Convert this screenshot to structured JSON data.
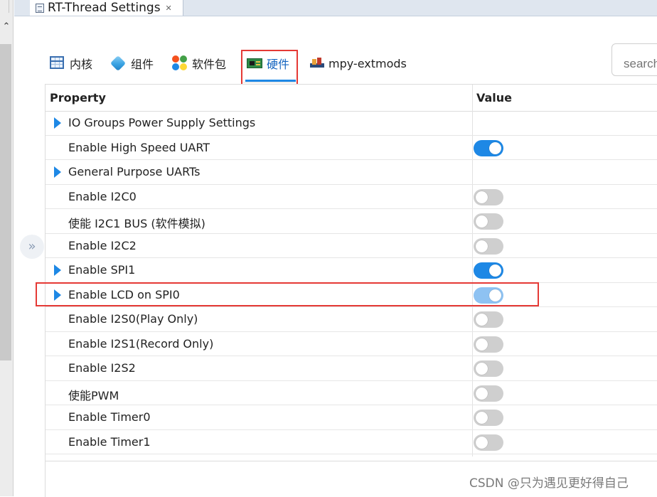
{
  "editor": {
    "tab_title": "RT-Thread Settings",
    "close_glyph": "✕"
  },
  "tabs": [
    {
      "label": "内核",
      "icon": "kernel-icon"
    },
    {
      "label": "组件",
      "icon": "component-icon"
    },
    {
      "label": "软件包",
      "icon": "package-icon"
    },
    {
      "label": "硬件",
      "icon": "hardware-icon",
      "active": true
    },
    {
      "label": "mpy-extmods",
      "icon": "mpy-extmods-icon"
    }
  ],
  "search": {
    "placeholder": "search"
  },
  "table": {
    "headers": {
      "property": "Property",
      "value": "Value"
    },
    "rows": [
      {
        "label": "IO Groups Power Supply Settings",
        "expandable": true,
        "toggle": null
      },
      {
        "label": "Enable High Speed UART",
        "expandable": false,
        "toggle": "on"
      },
      {
        "label": "General Purpose UARTs",
        "expandable": true,
        "toggle": null
      },
      {
        "label": "Enable I2C0",
        "expandable": false,
        "toggle": "off"
      },
      {
        "label": "使能 I2C1 BUS (软件模拟)",
        "expandable": false,
        "toggle": "off"
      },
      {
        "label": "Enable I2C2",
        "expandable": false,
        "toggle": "off"
      },
      {
        "label": "Enable SPI1",
        "expandable": true,
        "toggle": "on"
      },
      {
        "label": "Enable LCD on SPI0",
        "expandable": true,
        "toggle": "on-light",
        "highlighted": true
      },
      {
        "label": "Enable I2S0(Play Only)",
        "expandable": false,
        "toggle": "off"
      },
      {
        "label": "Enable I2S1(Record Only)",
        "expandable": false,
        "toggle": "off"
      },
      {
        "label": "Enable I2S2",
        "expandable": false,
        "toggle": "off"
      },
      {
        "label": "使能PWM",
        "expandable": false,
        "toggle": "off"
      },
      {
        "label": "Enable Timer0",
        "expandable": false,
        "toggle": "off"
      },
      {
        "label": "Enable Timer1",
        "expandable": false,
        "toggle": "off"
      }
    ]
  },
  "side": {
    "collapse_glyph": "»"
  },
  "watermark": "CSDN @只为遇见更好得自己",
  "colors": {
    "accent": "#1e88e5",
    "highlight": "#e53935",
    "toggle_off": "#cfcfcf"
  }
}
